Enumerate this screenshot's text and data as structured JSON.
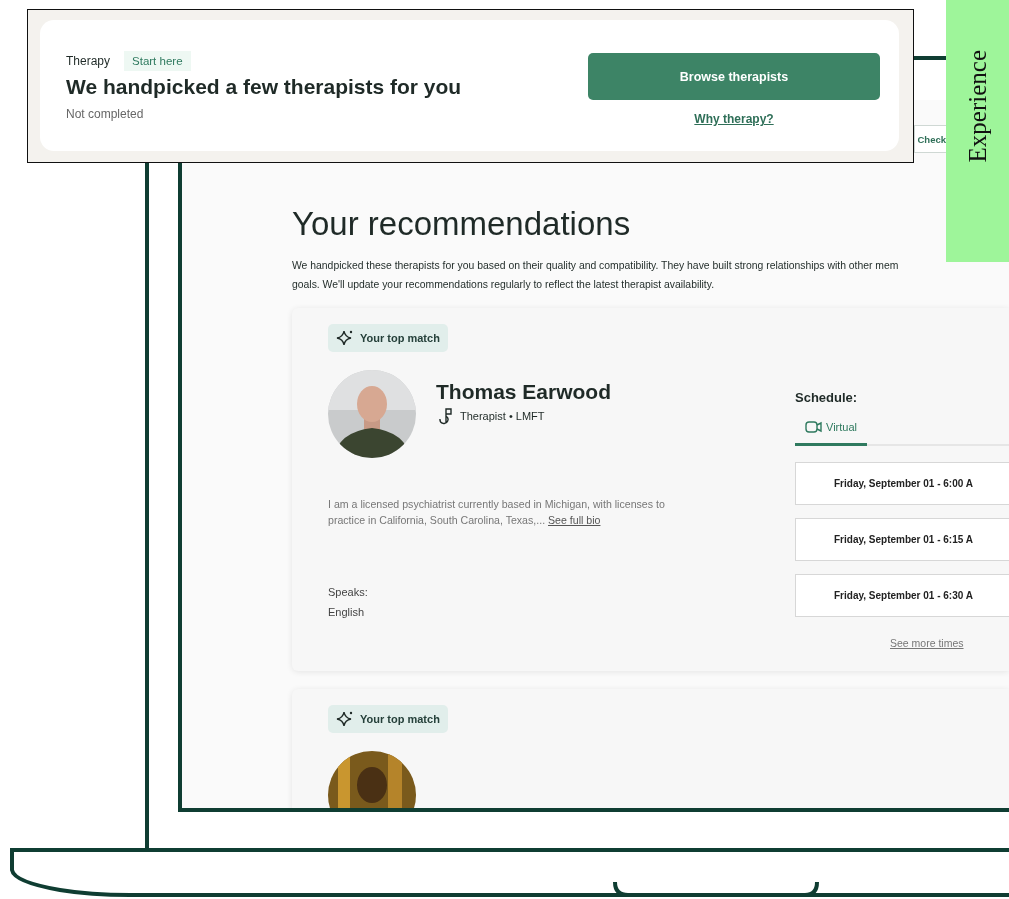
{
  "callout": {
    "category": "Therapy",
    "badge": "Start here",
    "title": "We handpicked a few therapists for you",
    "status": "Not completed",
    "primary_button": "Browse therapists",
    "link": "Why therapy?"
  },
  "side_tab": {
    "label": "Experience"
  },
  "header_button": "Check",
  "page": {
    "heading": "Your recommendations",
    "intro": [
      "We handpicked these therapists for you based on their quality and compatibility. They have built strong relationships with other mem",
      "goals. We'll update your recommendations regularly to reflect the latest therapist availability."
    ]
  },
  "cards": [
    {
      "badge": "Your top match",
      "name": "Thomas Earwood",
      "role": "Therapist • LMFT",
      "bio": "I am a licensed psychiatrist currently based in Michigan, with licenses to practice in California, South Carolina, Texas,...",
      "bio_link": "See full bio",
      "speaks_label": "Speaks:",
      "language": "English",
      "schedule_label": "Schedule:",
      "tabs": [
        {
          "label": "Virtual",
          "selected": true
        }
      ],
      "slots": [
        "Friday, September 01 - 6:00 A",
        "Friday, September 01 - 6:15 A",
        "Friday, September 01 - 6:30 A"
      ],
      "more_link": "See more times"
    },
    {
      "badge": "Your top match"
    }
  ]
}
